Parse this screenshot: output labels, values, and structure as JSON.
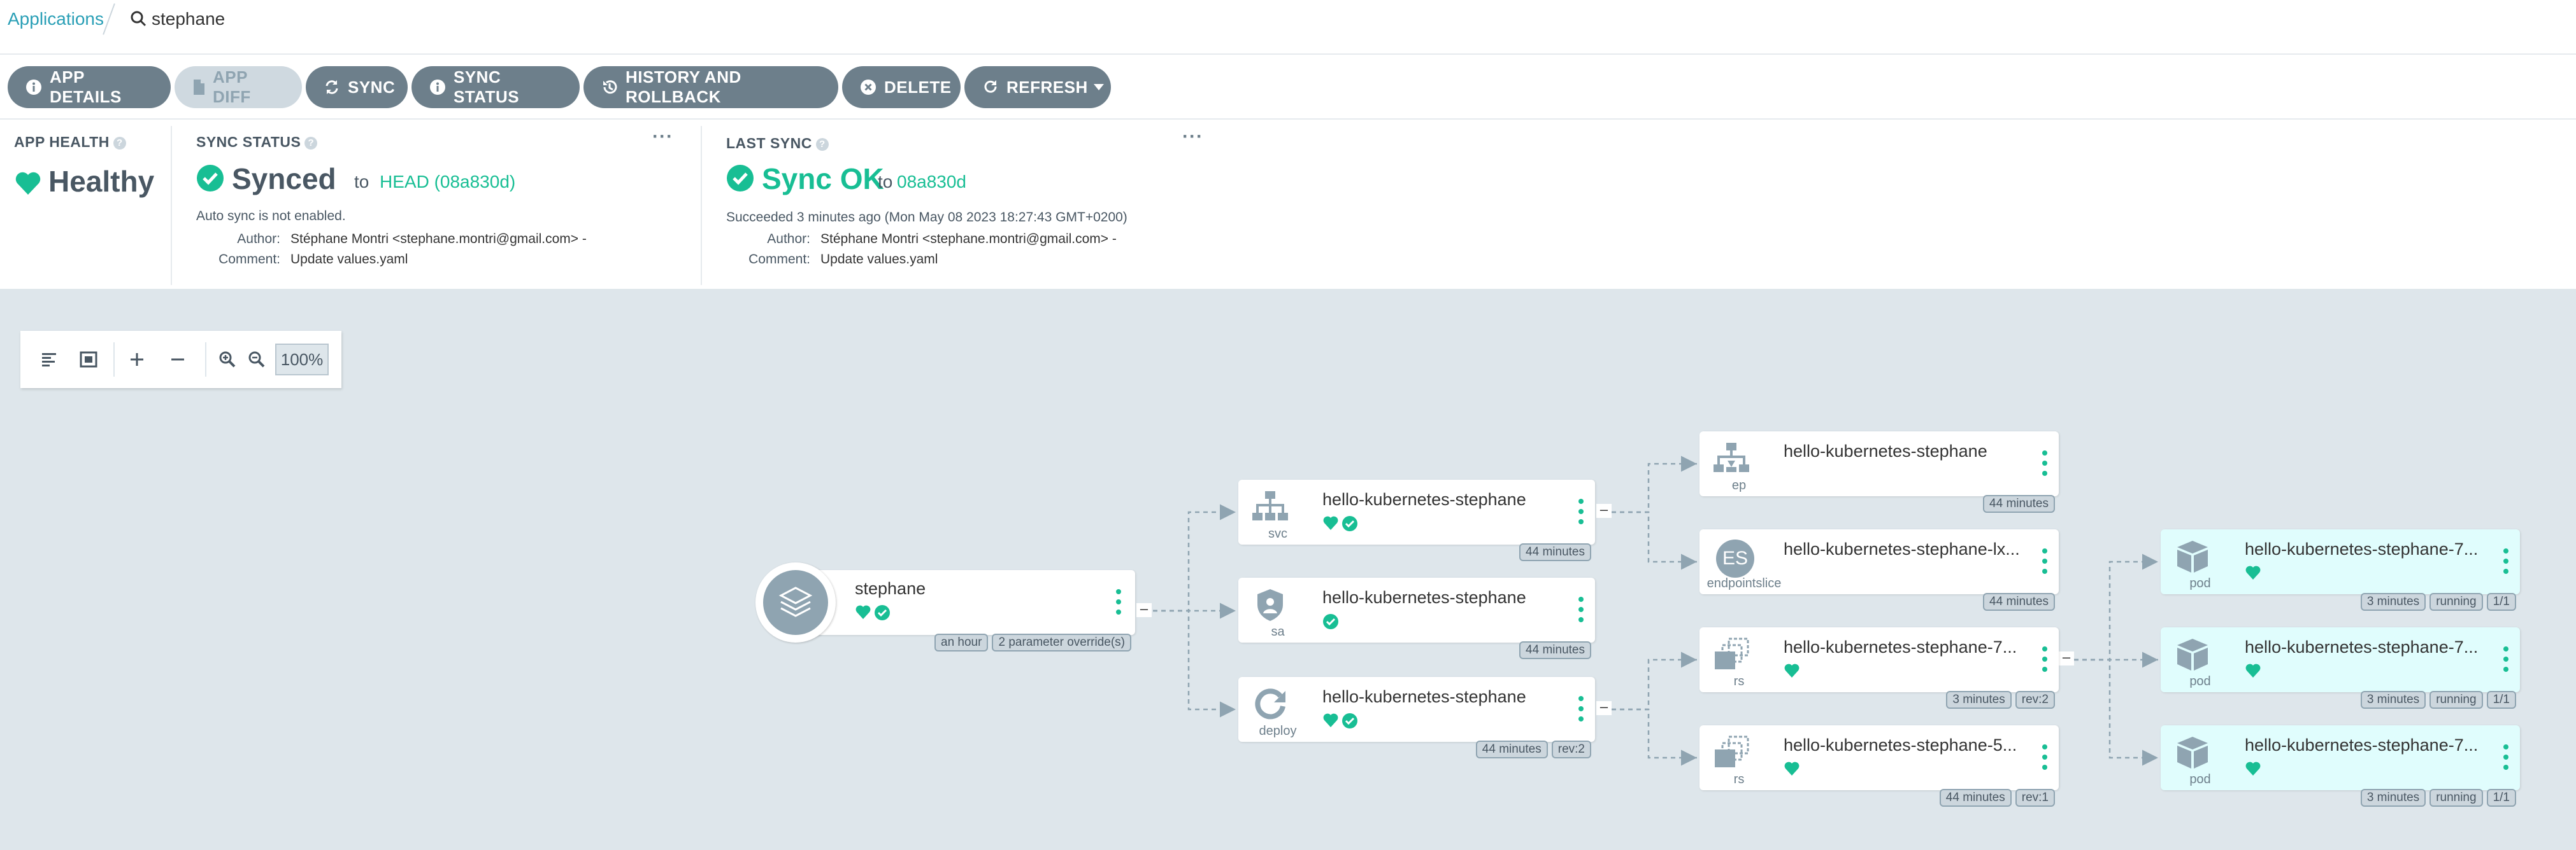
{
  "breadcrumb": {
    "applications": "Applications",
    "current": "stephane"
  },
  "toolbar": {
    "app_details": "APP DETAILS",
    "app_diff": "APP DIFF",
    "sync": "SYNC",
    "sync_status": "SYNC STATUS",
    "history": "HISTORY AND ROLLBACK",
    "delete": "DELETE",
    "refresh": "REFRESH"
  },
  "app_health": {
    "title": "APP HEALTH",
    "value": "Healthy"
  },
  "sync_status": {
    "title": "SYNC STATUS",
    "value": "Synced",
    "to": "to",
    "revision": "HEAD (08a830d)",
    "auto_sync": "Auto sync is not enabled.",
    "author_label": "Author:",
    "author": "Stéphane Montri <stephane.montri@gmail.com> -",
    "comment_label": "Comment:",
    "comment": "Update values.yaml"
  },
  "last_sync": {
    "title": "LAST SYNC",
    "value": "Sync OK",
    "to": "to",
    "revision": "08a830d",
    "succeeded": "Succeeded 3 minutes ago (Mon May 08 2023 18:27:43 GMT+0200)",
    "author_label": "Author:",
    "author": "Stéphane Montri <stephane.montri@gmail.com> -",
    "comment_label": "Comment:",
    "comment": "Update values.yaml"
  },
  "graph_tools": {
    "zoom": "100%"
  },
  "colors": {
    "healthy": "#18be94",
    "button": "#6d7f8b",
    "link": "#2a9fb6",
    "graph_bg": "#dee6eb",
    "arrow": "#e8392d"
  },
  "app_node": {
    "name": "stephane",
    "tags": [
      "an hour",
      "2 parameter override(s)"
    ]
  },
  "nodes": {
    "svc": {
      "name": "hello-kubernetes-stephane",
      "kind": "svc",
      "tags": [
        "44 minutes"
      ]
    },
    "sa": {
      "name": "hello-kubernetes-stephane",
      "kind": "sa",
      "tags": [
        "44 minutes"
      ]
    },
    "deploy": {
      "name": "hello-kubernetes-stephane",
      "kind": "deploy",
      "tags": [
        "44 minutes",
        "rev:2"
      ]
    },
    "ep": {
      "name": "hello-kubernetes-stephane",
      "kind": "ep",
      "tags": [
        "44 minutes"
      ]
    },
    "es": {
      "name": "hello-kubernetes-stephane-lx...",
      "kind": "endpointslice",
      "badge": "ES",
      "tags": [
        "44 minutes"
      ]
    },
    "rs1": {
      "name": "hello-kubernetes-stephane-7...",
      "kind": "rs",
      "tags": [
        "3 minutes",
        "rev:2"
      ]
    },
    "rs2": {
      "name": "hello-kubernetes-stephane-5...",
      "kind": "rs",
      "tags": [
        "44 minutes",
        "rev:1"
      ]
    },
    "pod1": {
      "name": "hello-kubernetes-stephane-7...",
      "kind": "pod",
      "tags": [
        "3 minutes",
        "running",
        "1/1"
      ]
    },
    "pod2": {
      "name": "hello-kubernetes-stephane-7...",
      "kind": "pod",
      "tags": [
        "3 minutes",
        "running",
        "1/1"
      ]
    },
    "pod3": {
      "name": "hello-kubernetes-stephane-7...",
      "kind": "pod",
      "tags": [
        "3 minutes",
        "running",
        "1/1"
      ]
    }
  }
}
